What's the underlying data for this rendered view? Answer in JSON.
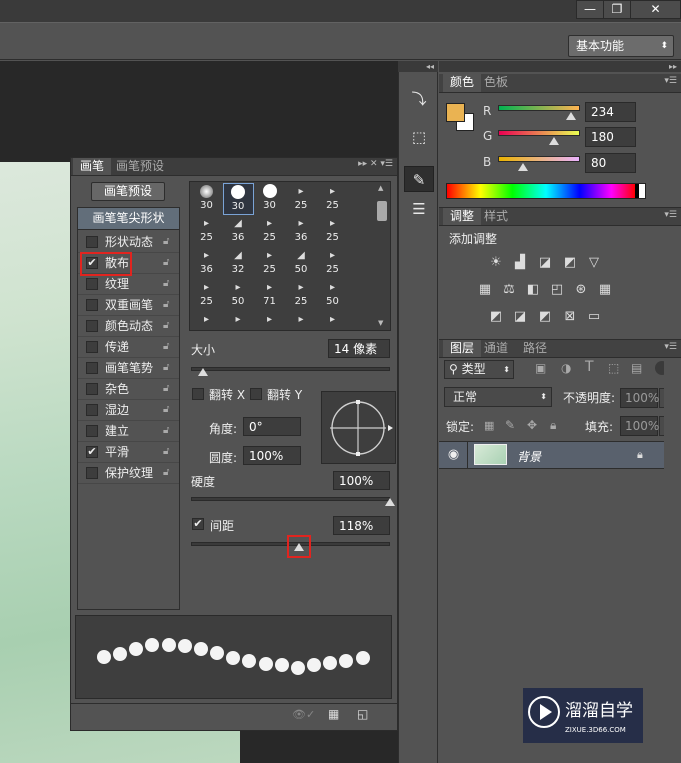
{
  "window": {
    "minimize": "—",
    "restore": "❐",
    "close": "✕"
  },
  "options_bar": {
    "workspace": "基本功能"
  },
  "tools": [
    "history-brush-icon",
    "cube-icon",
    "brush-tool-icon",
    "sliders-icon"
  ],
  "color_panel": {
    "tabs": [
      "颜色",
      "色板"
    ],
    "foreground": "#eab352",
    "channels": [
      {
        "label": "R",
        "value": "234",
        "fraction": 0.918,
        "gradient": "linear-gradient(90deg,#00b351,#ffb351)"
      },
      {
        "label": "G",
        "value": "180",
        "fraction": 0.706,
        "gradient": "linear-gradient(90deg,#ea0052,#eaff52)"
      },
      {
        "label": "B",
        "value": "80",
        "fraction": 0.314,
        "gradient": "linear-gradient(90deg,#eab300,#eab3ff)"
      }
    ]
  },
  "adjustments_panel": {
    "tabs": [
      "调整",
      "样式"
    ],
    "title": "添加调整"
  },
  "layers_panel": {
    "tabs": [
      "图层",
      "通道",
      "路径"
    ],
    "filter_type": "类型",
    "blend_mode": "正常",
    "opacity_label": "不透明度:",
    "opacity_value": "100%",
    "lock_label": "锁定:",
    "fill_label": "填充:",
    "fill_value": "100%",
    "layer_name": "背景"
  },
  "brush_panel": {
    "tabs": [
      "画笔",
      "画笔预设"
    ],
    "presets_button": "画笔预设",
    "tip_shape_header": "画笔笔尖形状",
    "options": [
      {
        "label": "形状动态",
        "checked": false
      },
      {
        "label": "散布",
        "checked": true
      },
      {
        "label": "纹理",
        "checked": false
      },
      {
        "label": "双重画笔",
        "checked": false
      },
      {
        "label": "颜色动态",
        "checked": false
      },
      {
        "label": "传递",
        "checked": false
      },
      {
        "label": "画笔笔势",
        "checked": false
      },
      {
        "label": "杂色",
        "checked": false
      },
      {
        "label": "湿边",
        "checked": false
      },
      {
        "label": "建立",
        "checked": false
      },
      {
        "label": "平滑",
        "checked": true
      },
      {
        "label": "保护纹理",
        "checked": false
      }
    ],
    "tip_sizes": [
      [
        "30",
        "30",
        "30",
        "25",
        "25"
      ],
      [
        "25",
        "36",
        "25",
        "36",
        "25"
      ],
      [
        "36",
        "32",
        "25",
        "50",
        "25"
      ],
      [
        "25",
        "50",
        "71",
        "25",
        "50"
      ],
      [
        "",
        "",
        "",
        "",
        ""
      ]
    ],
    "size_label": "大小",
    "size_value": "14 像素",
    "flip_x_label": "翻转 X",
    "flip_y_label": "翻转 Y",
    "angle_label": "角度:",
    "angle_value": "0°",
    "roundness_label": "圆度:",
    "roundness_value": "100%",
    "hardness_label": "硬度",
    "hardness_value": "100%",
    "spacing_label": "间距",
    "spacing_value": "118%"
  }
}
